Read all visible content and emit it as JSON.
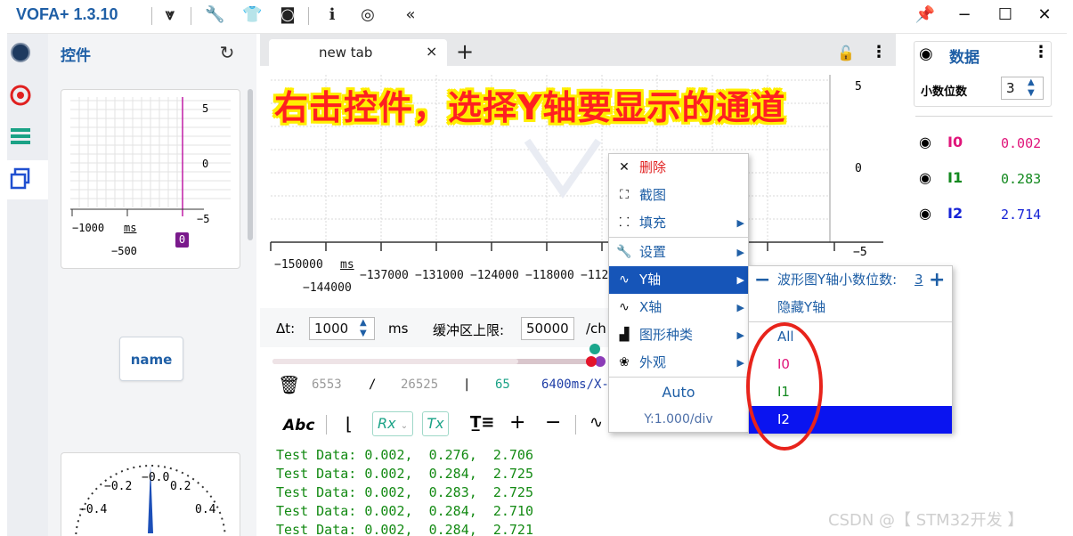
{
  "app": {
    "title": "VOFA+ 1.3.10"
  },
  "titlebar_icons": [
    "vofa-logo-icon",
    "wrench-icon",
    "shirt-icon",
    "screenshot-icon",
    "info-icon",
    "fingerprint-icon",
    "collapse-icon"
  ],
  "window_controls": [
    "pin-icon",
    "minimize-icon",
    "maximize-icon",
    "close-icon"
  ],
  "control_panel": {
    "title": "控件",
    "mini_wave": {
      "y_ticks": [
        "5",
        "0",
        "−5"
      ],
      "x_ticks": [
        "−1000",
        "ms",
        "−500"
      ],
      "marker": "0"
    },
    "button_label": "name",
    "gauge_ticks": [
      "−0.2",
      "−0.0",
      "0.2",
      "−0.4",
      "0.4"
    ]
  },
  "tab": {
    "label": "new tab",
    "close": "×",
    "add": "+"
  },
  "annotation": "右击控件，选择Y轴要显示的通道",
  "plot": {
    "y_labels": [
      "5",
      "0",
      "−5"
    ],
    "x_labels_top": [
      "−150000",
      "ms",
      "−137000",
      "−131000",
      "−124000",
      "−118000",
      "−112"
    ],
    "x_labels_bottom": [
      "−144000"
    ]
  },
  "settings": {
    "dt_label": "Δt:",
    "dt_value": "1000",
    "dt_unit": "ms",
    "buffer_label": "缓冲区上限:",
    "buffer_value": "50000",
    "buffer_unit": "/ch"
  },
  "stats": {
    "count": "6553",
    "slash": "/",
    "total": "26525",
    "bar": "|",
    "rate": "65",
    "scale": "6400ms/X-"
  },
  "toolbar": {
    "abc": "Abc",
    "rx": "Rx",
    "tx": "Tx",
    "plus": "+",
    "minus": "−"
  },
  "console": {
    "lines": [
      "Test Data: 0.002,  0.276,  2.706",
      "Test Data: 0.002,  0.284,  2.725",
      "Test Data: 0.002,  0.283,  2.725",
      "Test Data: 0.002,  0.284,  2.710",
      "Test Data: 0.002,  0.284,  2.721"
    ]
  },
  "data_panel": {
    "title": "数据",
    "decimals_label": "小数位数",
    "decimals_value": "3",
    "channels": [
      {
        "name": "I0",
        "value": "0.002",
        "color": "#e0157a"
      },
      {
        "name": "I1",
        "value": "0.283",
        "color": "#13891f"
      },
      {
        "name": "I2",
        "value": "2.714",
        "color": "#1522d6"
      }
    ]
  },
  "context_menu": {
    "items": [
      {
        "icon": "✕",
        "label": "删除",
        "arrow": ""
      },
      {
        "icon": "⛶",
        "label": "截图",
        "arrow": ""
      },
      {
        "icon": "⸬",
        "label": "填充",
        "arrow": "▶"
      },
      {
        "icon": "🔧",
        "label": "设置",
        "arrow": "▶"
      },
      {
        "icon": "∿",
        "label": "Y轴",
        "arrow": "▶"
      },
      {
        "icon": "∿",
        "label": "X轴",
        "arrow": "▶"
      },
      {
        "icon": "▟",
        "label": "图形种类",
        "arrow": "▶"
      },
      {
        "icon": "❀",
        "label": "外观",
        "arrow": "▶"
      }
    ],
    "auto_label": "Auto",
    "ydiv_label": "Y:1.000/div"
  },
  "y_submenu": {
    "decimals_label": "波形图Y轴小数位数:",
    "decimals_value": "3",
    "hide_label": "隐藏Y轴",
    "options": [
      "All",
      "I0",
      "I1",
      "I2"
    ]
  },
  "watermark": "CSDN @【 STM32开发 】"
}
